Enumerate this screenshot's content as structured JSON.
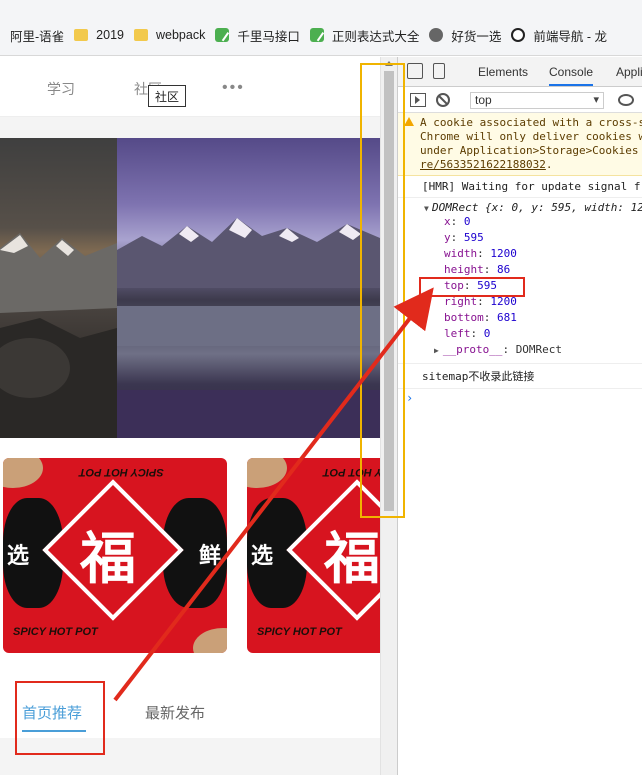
{
  "bookmarks": [
    {
      "label": "阿里-语雀",
      "icon": "none"
    },
    {
      "label": "2019",
      "icon": "folder-icon"
    },
    {
      "label": "webpack",
      "icon": "folder-icon"
    },
    {
      "label": "千里马接口",
      "icon": "leaf-icon"
    },
    {
      "label": "正则表达式大全",
      "icon": "leaf-icon"
    },
    {
      "label": "好货一选",
      "icon": "globe-icon"
    },
    {
      "label": "前端导航 - 龙",
      "icon": "cat-icon"
    }
  ],
  "page": {
    "nav": {
      "item1": "学习",
      "item2": "社区",
      "more": "•••",
      "tooltip": "社区"
    },
    "cards": {
      "top_text": "SPICY HOT POT",
      "bottom_text": "SPICY HOT POT",
      "center_glyph": "福",
      "left_glyph": "选",
      "right_glyph": "鲜"
    },
    "tabs": {
      "active": "首页推荐",
      "inactive": "最新发布"
    }
  },
  "devtools": {
    "tabs": {
      "elements": "Elements",
      "console": "Console",
      "application": "Appli"
    },
    "context": "top",
    "warning": {
      "line1": "A cookie associated with a cross-s",
      "line2": "Chrome will only deliver cookies w",
      "line3": "under Application>Storage>Cookies",
      "link": "re/5633521622188032",
      "link_end": "."
    },
    "hmr": "[HMR] Waiting for update signal fr",
    "domrect": {
      "head": "DOMRect {x: 0, y: 595, width: 12",
      "props": [
        {
          "k": "x",
          "v": "0"
        },
        {
          "k": "y",
          "v": "595"
        },
        {
          "k": "width",
          "v": "1200"
        },
        {
          "k": "height",
          "v": "86"
        },
        {
          "k": "top",
          "v": "595"
        },
        {
          "k": "right",
          "v": "1200"
        },
        {
          "k": "bottom",
          "v": "681"
        },
        {
          "k": "left",
          "v": "0"
        }
      ],
      "proto_key": "__proto__",
      "proto_val": "DOMRect"
    },
    "sitemap": "sitemap不收录此链接",
    "prompt": "›"
  },
  "colors": {
    "accent_blue": "#4a9ed8",
    "annotation_red": "#e12a1c",
    "annotation_yellow": "#f0b400"
  }
}
